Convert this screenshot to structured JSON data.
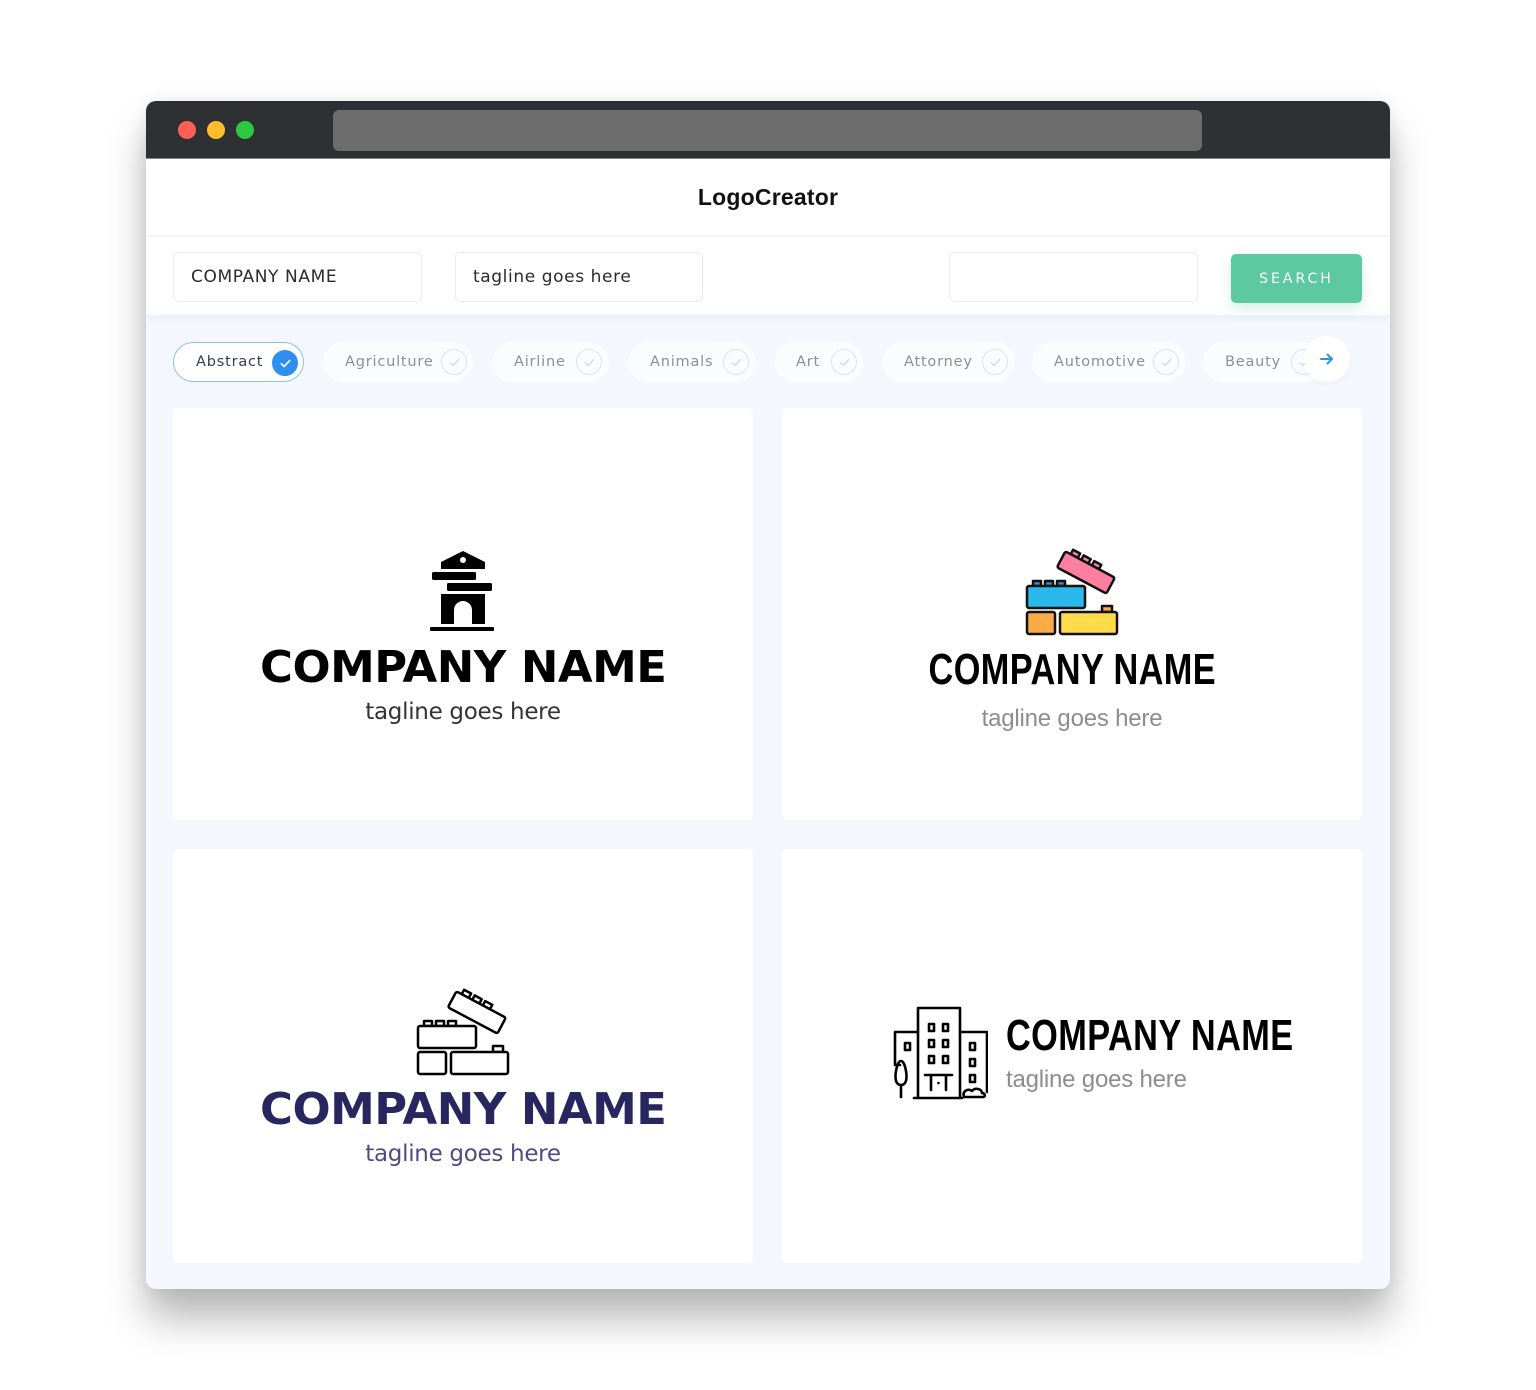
{
  "window": {
    "controls": [
      "close",
      "minimize",
      "maximize"
    ],
    "colors": {
      "close": "#fe5f57",
      "minimize": "#febc2e",
      "maximize": "#2bc840"
    }
  },
  "header": {
    "brand": "LogoCreator"
  },
  "search": {
    "company_value": "COMPANY NAME",
    "tagline_value": "tagline goes here",
    "extra_value": "",
    "button_label": "SEARCH",
    "button_color": "#5cc9a0"
  },
  "categories": {
    "items": [
      {
        "label": "Abstract",
        "selected": true
      },
      {
        "label": "Agriculture",
        "selected": false
      },
      {
        "label": "Airline",
        "selected": false
      },
      {
        "label": "Animals",
        "selected": false
      },
      {
        "label": "Art",
        "selected": false
      },
      {
        "label": "Attorney",
        "selected": false
      },
      {
        "label": "Automotive",
        "selected": false
      },
      {
        "label": "Beauty",
        "selected": false
      }
    ],
    "next_icon": "arrow-right-icon",
    "accent": "#2e8ff0"
  },
  "logos": [
    {
      "icon": "monument-arch-icon",
      "company": "COMPANY NAME",
      "tagline": "tagline goes here",
      "name_color": "#000000",
      "tagline_color": "#333333"
    },
    {
      "icon": "colored-bricks-icon",
      "company": "COMPANY NAME",
      "tagline": "tagline goes here",
      "name_color": "#000000",
      "tagline_color": "#8d8d8d"
    },
    {
      "icon": "outline-bricks-icon",
      "company": "COMPANY NAME",
      "tagline": "tagline goes here",
      "name_color": "#27265f",
      "tagline_color": "#4e4c80"
    },
    {
      "icon": "city-buildings-icon",
      "company": "COMPANY NAME",
      "tagline": "tagline goes here",
      "name_color": "#000000",
      "tagline_color": "#8d8d8d"
    }
  ]
}
